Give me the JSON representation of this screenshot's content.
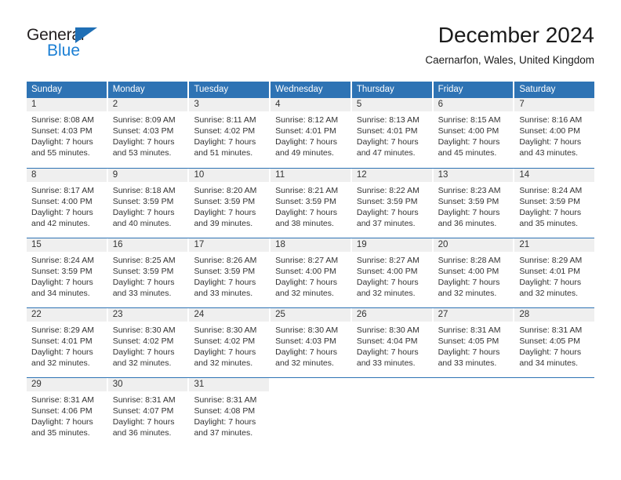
{
  "brand": {
    "line1": "General",
    "line2": "Blue",
    "icon": "triangle-logo",
    "color_dark": "#231f20",
    "color_blue": "#1b7fd4"
  },
  "header": {
    "month_title": "December 2024",
    "location": "Caernarfon, Wales, United Kingdom"
  },
  "theme": {
    "header_blue": "#2e73b4",
    "daynum_gray": "#efefef",
    "text": "#333333"
  },
  "calendar": {
    "weekdays": [
      "Sunday",
      "Monday",
      "Tuesday",
      "Wednesday",
      "Thursday",
      "Friday",
      "Saturday"
    ],
    "weeks": [
      [
        {
          "day": "1",
          "sunrise": "Sunrise: 8:08 AM",
          "sunset": "Sunset: 4:03 PM",
          "daylight1": "Daylight: 7 hours",
          "daylight2": "and 55 minutes."
        },
        {
          "day": "2",
          "sunrise": "Sunrise: 8:09 AM",
          "sunset": "Sunset: 4:03 PM",
          "daylight1": "Daylight: 7 hours",
          "daylight2": "and 53 minutes."
        },
        {
          "day": "3",
          "sunrise": "Sunrise: 8:11 AM",
          "sunset": "Sunset: 4:02 PM",
          "daylight1": "Daylight: 7 hours",
          "daylight2": "and 51 minutes."
        },
        {
          "day": "4",
          "sunrise": "Sunrise: 8:12 AM",
          "sunset": "Sunset: 4:01 PM",
          "daylight1": "Daylight: 7 hours",
          "daylight2": "and 49 minutes."
        },
        {
          "day": "5",
          "sunrise": "Sunrise: 8:13 AM",
          "sunset": "Sunset: 4:01 PM",
          "daylight1": "Daylight: 7 hours",
          "daylight2": "and 47 minutes."
        },
        {
          "day": "6",
          "sunrise": "Sunrise: 8:15 AM",
          "sunset": "Sunset: 4:00 PM",
          "daylight1": "Daylight: 7 hours",
          "daylight2": "and 45 minutes."
        },
        {
          "day": "7",
          "sunrise": "Sunrise: 8:16 AM",
          "sunset": "Sunset: 4:00 PM",
          "daylight1": "Daylight: 7 hours",
          "daylight2": "and 43 minutes."
        }
      ],
      [
        {
          "day": "8",
          "sunrise": "Sunrise: 8:17 AM",
          "sunset": "Sunset: 4:00 PM",
          "daylight1": "Daylight: 7 hours",
          "daylight2": "and 42 minutes."
        },
        {
          "day": "9",
          "sunrise": "Sunrise: 8:18 AM",
          "sunset": "Sunset: 3:59 PM",
          "daylight1": "Daylight: 7 hours",
          "daylight2": "and 40 minutes."
        },
        {
          "day": "10",
          "sunrise": "Sunrise: 8:20 AM",
          "sunset": "Sunset: 3:59 PM",
          "daylight1": "Daylight: 7 hours",
          "daylight2": "and 39 minutes."
        },
        {
          "day": "11",
          "sunrise": "Sunrise: 8:21 AM",
          "sunset": "Sunset: 3:59 PM",
          "daylight1": "Daylight: 7 hours",
          "daylight2": "and 38 minutes."
        },
        {
          "day": "12",
          "sunrise": "Sunrise: 8:22 AM",
          "sunset": "Sunset: 3:59 PM",
          "daylight1": "Daylight: 7 hours",
          "daylight2": "and 37 minutes."
        },
        {
          "day": "13",
          "sunrise": "Sunrise: 8:23 AM",
          "sunset": "Sunset: 3:59 PM",
          "daylight1": "Daylight: 7 hours",
          "daylight2": "and 36 minutes."
        },
        {
          "day": "14",
          "sunrise": "Sunrise: 8:24 AM",
          "sunset": "Sunset: 3:59 PM",
          "daylight1": "Daylight: 7 hours",
          "daylight2": "and 35 minutes."
        }
      ],
      [
        {
          "day": "15",
          "sunrise": "Sunrise: 8:24 AM",
          "sunset": "Sunset: 3:59 PM",
          "daylight1": "Daylight: 7 hours",
          "daylight2": "and 34 minutes."
        },
        {
          "day": "16",
          "sunrise": "Sunrise: 8:25 AM",
          "sunset": "Sunset: 3:59 PM",
          "daylight1": "Daylight: 7 hours",
          "daylight2": "and 33 minutes."
        },
        {
          "day": "17",
          "sunrise": "Sunrise: 8:26 AM",
          "sunset": "Sunset: 3:59 PM",
          "daylight1": "Daylight: 7 hours",
          "daylight2": "and 33 minutes."
        },
        {
          "day": "18",
          "sunrise": "Sunrise: 8:27 AM",
          "sunset": "Sunset: 4:00 PM",
          "daylight1": "Daylight: 7 hours",
          "daylight2": "and 32 minutes."
        },
        {
          "day": "19",
          "sunrise": "Sunrise: 8:27 AM",
          "sunset": "Sunset: 4:00 PM",
          "daylight1": "Daylight: 7 hours",
          "daylight2": "and 32 minutes."
        },
        {
          "day": "20",
          "sunrise": "Sunrise: 8:28 AM",
          "sunset": "Sunset: 4:00 PM",
          "daylight1": "Daylight: 7 hours",
          "daylight2": "and 32 minutes."
        },
        {
          "day": "21",
          "sunrise": "Sunrise: 8:29 AM",
          "sunset": "Sunset: 4:01 PM",
          "daylight1": "Daylight: 7 hours",
          "daylight2": "and 32 minutes."
        }
      ],
      [
        {
          "day": "22",
          "sunrise": "Sunrise: 8:29 AM",
          "sunset": "Sunset: 4:01 PM",
          "daylight1": "Daylight: 7 hours",
          "daylight2": "and 32 minutes."
        },
        {
          "day": "23",
          "sunrise": "Sunrise: 8:30 AM",
          "sunset": "Sunset: 4:02 PM",
          "daylight1": "Daylight: 7 hours",
          "daylight2": "and 32 minutes."
        },
        {
          "day": "24",
          "sunrise": "Sunrise: 8:30 AM",
          "sunset": "Sunset: 4:02 PM",
          "daylight1": "Daylight: 7 hours",
          "daylight2": "and 32 minutes."
        },
        {
          "day": "25",
          "sunrise": "Sunrise: 8:30 AM",
          "sunset": "Sunset: 4:03 PM",
          "daylight1": "Daylight: 7 hours",
          "daylight2": "and 32 minutes."
        },
        {
          "day": "26",
          "sunrise": "Sunrise: 8:30 AM",
          "sunset": "Sunset: 4:04 PM",
          "daylight1": "Daylight: 7 hours",
          "daylight2": "and 33 minutes."
        },
        {
          "day": "27",
          "sunrise": "Sunrise: 8:31 AM",
          "sunset": "Sunset: 4:05 PM",
          "daylight1": "Daylight: 7 hours",
          "daylight2": "and 33 minutes."
        },
        {
          "day": "28",
          "sunrise": "Sunrise: 8:31 AM",
          "sunset": "Sunset: 4:05 PM",
          "daylight1": "Daylight: 7 hours",
          "daylight2": "and 34 minutes."
        }
      ],
      [
        {
          "day": "29",
          "sunrise": "Sunrise: 8:31 AM",
          "sunset": "Sunset: 4:06 PM",
          "daylight1": "Daylight: 7 hours",
          "daylight2": "and 35 minutes."
        },
        {
          "day": "30",
          "sunrise": "Sunrise: 8:31 AM",
          "sunset": "Sunset: 4:07 PM",
          "daylight1": "Daylight: 7 hours",
          "daylight2": "and 36 minutes."
        },
        {
          "day": "31",
          "sunrise": "Sunrise: 8:31 AM",
          "sunset": "Sunset: 4:08 PM",
          "daylight1": "Daylight: 7 hours",
          "daylight2": "and 37 minutes."
        },
        {
          "day": "",
          "sunrise": "",
          "sunset": "",
          "daylight1": "",
          "daylight2": ""
        },
        {
          "day": "",
          "sunrise": "",
          "sunset": "",
          "daylight1": "",
          "daylight2": ""
        },
        {
          "day": "",
          "sunrise": "",
          "sunset": "",
          "daylight1": "",
          "daylight2": ""
        },
        {
          "day": "",
          "sunrise": "",
          "sunset": "",
          "daylight1": "",
          "daylight2": ""
        }
      ]
    ]
  }
}
